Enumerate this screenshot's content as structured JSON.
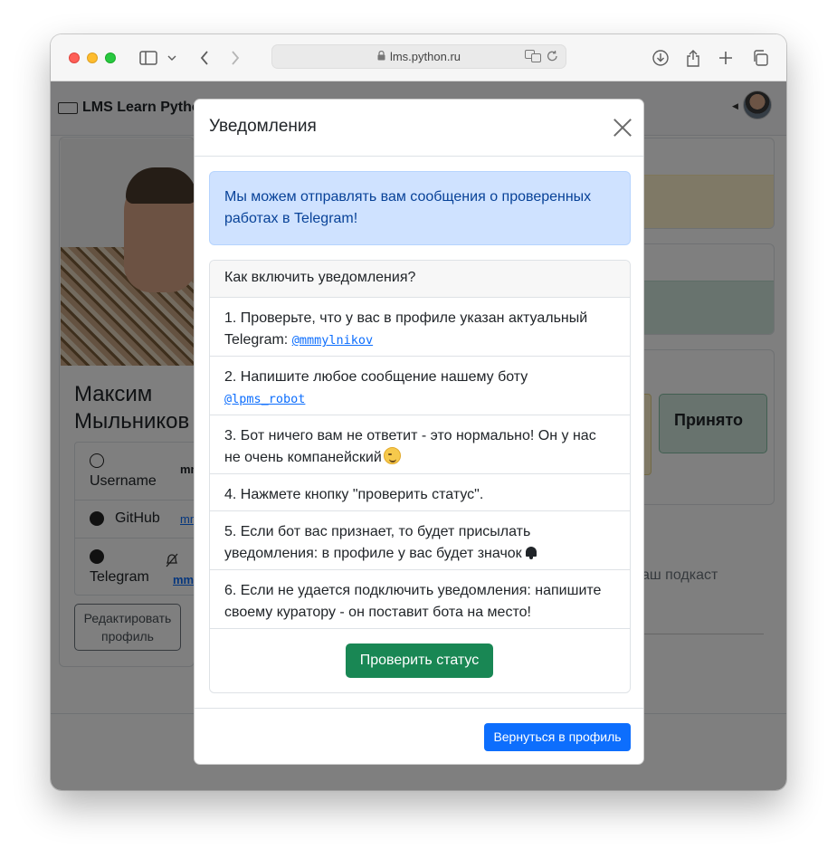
{
  "browser": {
    "url": "lms.python.ru"
  },
  "navbar": {
    "brand": "LMS Learn Python"
  },
  "profile": {
    "name": "Максим Мыльников",
    "rows": [
      {
        "label": "Username",
        "value": "mm"
      },
      {
        "label": "GitHub",
        "value": "mm"
      },
      {
        "label": "Telegram",
        "value": "mm"
      }
    ],
    "edit_button": "Редактировать профиль"
  },
  "background": {
    "status_accepted": "Принято",
    "podcast_text": "аш подкаст"
  },
  "modal": {
    "title": "Уведомления",
    "alert": "Мы можем отправлять вам сообщения о проверенных работах в Telegram!",
    "howto_header": "Как включить уведомления?",
    "steps": [
      {
        "text": "1. Проверьте, что у вас в профиле указан актуальный Telegram: ",
        "code": "@mmmylnikov"
      },
      {
        "text": "2. Напишите любое сообщение нашему боту ",
        "code": "@lpms_robot"
      },
      {
        "text": "3. Бот ничего вам не ответит - это нормально! Он у нас не очень компанейский"
      },
      {
        "text": "4. Нажмете кнопку \"проверить статус\"."
      },
      {
        "text": "5. Если бот вас признает, то будет присылать уведомления: в профиле у вас будет значок"
      },
      {
        "text": "6. Если не удается подключить уведомления: напишите своему куратору - он поставит бота на место!"
      }
    ],
    "check_button": "Проверить статус",
    "back_button": "Вернуться в профиль"
  }
}
